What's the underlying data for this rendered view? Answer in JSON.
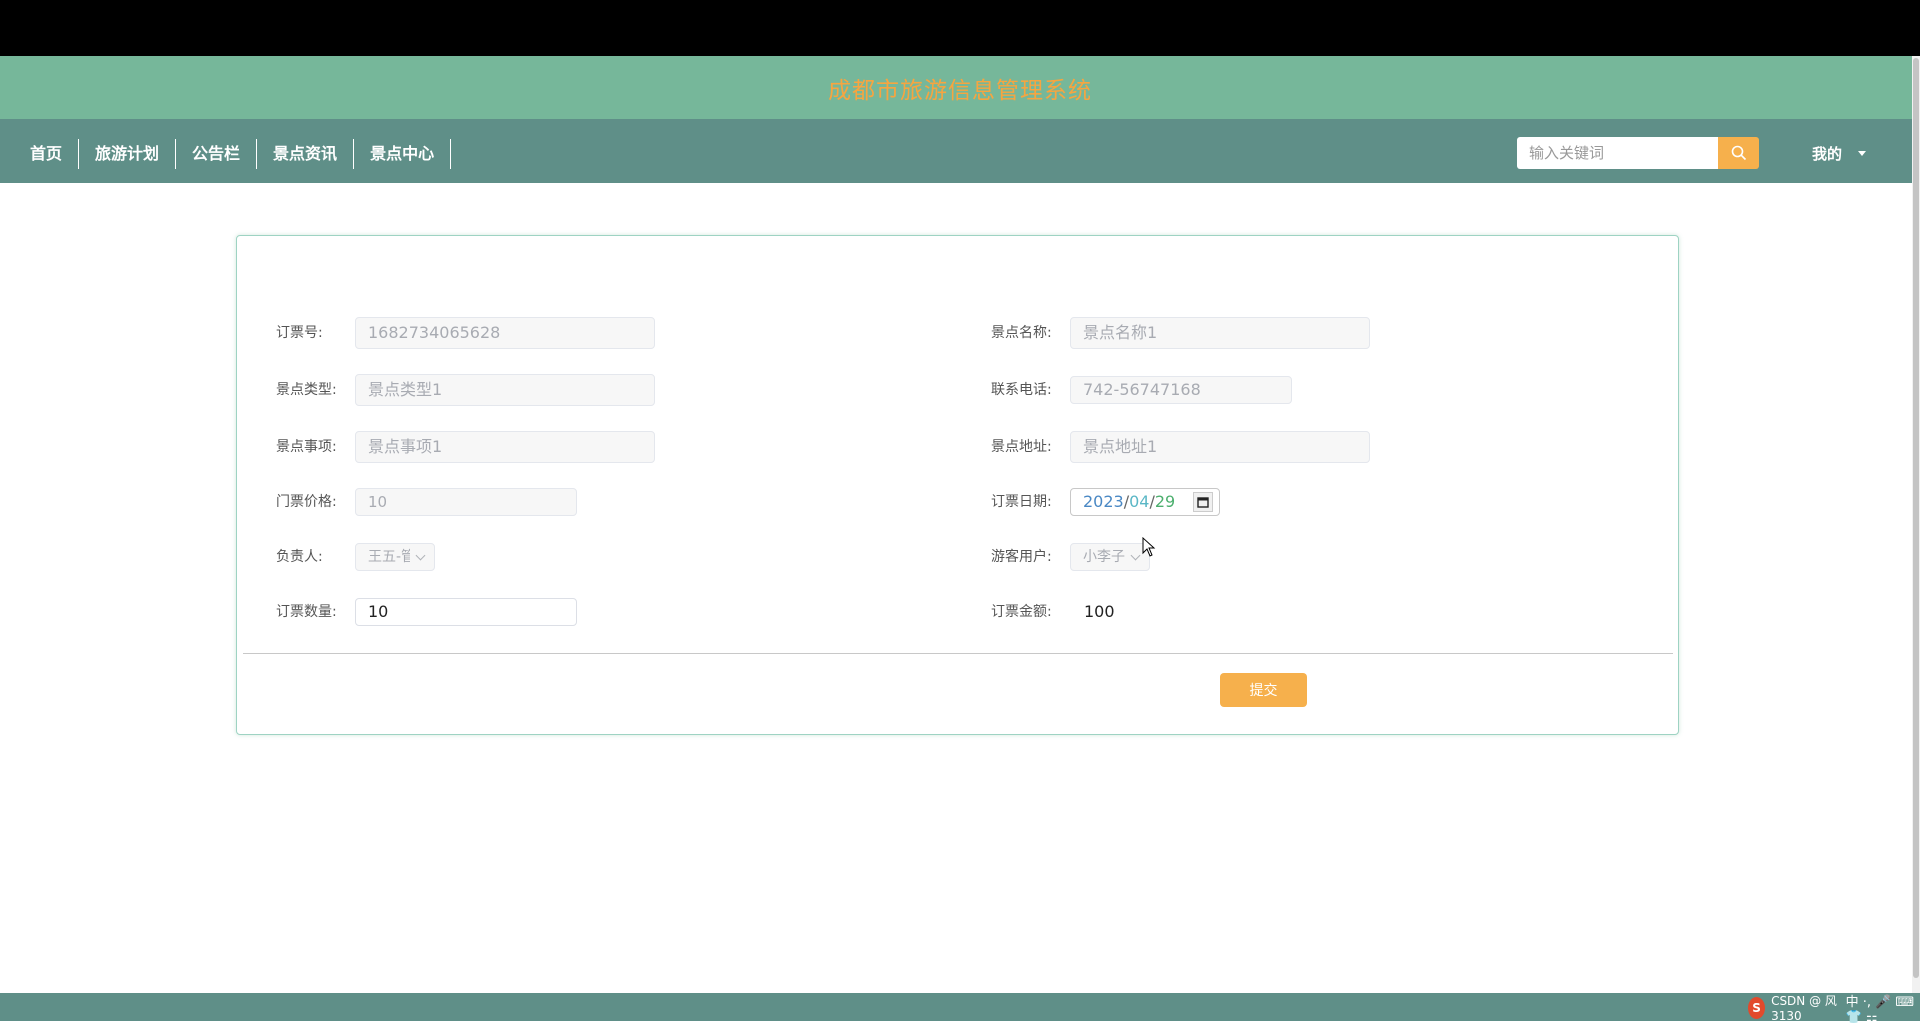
{
  "header": {
    "title": "成都市旅游信息管理系统"
  },
  "nav": {
    "items": [
      {
        "label": "首页"
      },
      {
        "label": "旅游计划"
      },
      {
        "label": "公告栏"
      },
      {
        "label": "景点资讯"
      },
      {
        "label": "景点中心"
      }
    ],
    "search_placeholder": "输入关键词",
    "user_menu_label": "我的"
  },
  "form": {
    "order_no": {
      "label": "订票号:",
      "value": "1682734065628"
    },
    "spot_name": {
      "label": "景点名称:",
      "value": "景点名称1"
    },
    "spot_type": {
      "label": "景点类型:",
      "value": "景点类型1"
    },
    "phone": {
      "label": "联系电话:",
      "value": "742-56747168"
    },
    "spot_matter": {
      "label": "景点事项:",
      "value": "景点事项1"
    },
    "spot_address": {
      "label": "景点地址:",
      "value": "景点地址1"
    },
    "ticket_price": {
      "label": "门票价格:",
      "value": "10"
    },
    "order_date": {
      "label": "订票日期:",
      "year": "2023",
      "month": "04",
      "day": "29",
      "sep": "/"
    },
    "manager": {
      "label": "负责人:",
      "value": "王五-管"
    },
    "visitor": {
      "label": "游客用户:",
      "value": "小李子"
    },
    "quantity": {
      "label": "订票数量:",
      "value": "10"
    },
    "amount": {
      "label": "订票金额:",
      "value": "100"
    },
    "submit_label": "提交"
  },
  "tray": {
    "logo": "S",
    "text": "中 ·, 🎤 ⌨ 👕 ⚏",
    "watermark": "CSDN @ 风3130"
  },
  "colors": {
    "header_bg": "#76b79a",
    "nav_bg": "#5f8f88",
    "accent": "#f6b04c",
    "title_color": "#f6a540"
  }
}
